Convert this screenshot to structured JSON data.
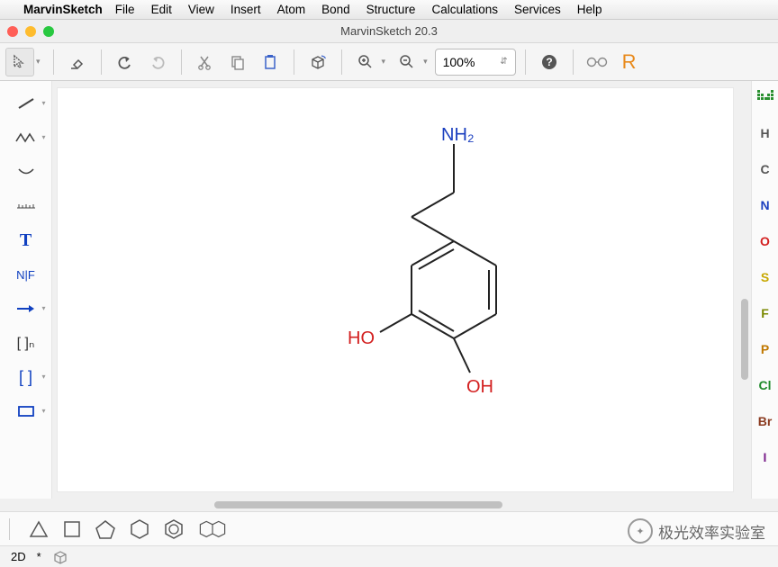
{
  "menubar": {
    "app": "MarvinSketch",
    "items": [
      "File",
      "Edit",
      "View",
      "Insert",
      "Atom",
      "Bond",
      "Structure",
      "Calculations",
      "Services",
      "Help"
    ]
  },
  "window": {
    "title": "MarvinSketch 20.3"
  },
  "toolbar": {
    "zoom": "100%",
    "r_label": "R"
  },
  "leftTools": {
    "text_label": "T",
    "name_label": "N|F",
    "bracket1": "[ ]ₙ",
    "bracket2": "[ ]"
  },
  "elements": {
    "h": "H",
    "c": "C",
    "n": "N",
    "o": "O",
    "s": "S",
    "f": "F",
    "p": "P",
    "cl": "Cl",
    "br": "Br",
    "i": "I"
  },
  "molecule": {
    "nh2": "NH₂",
    "ho": "HO",
    "oh": "OH"
  },
  "status": {
    "mode": "2D",
    "mark": "*"
  },
  "watermark": {
    "text": "极光效率实验室"
  }
}
